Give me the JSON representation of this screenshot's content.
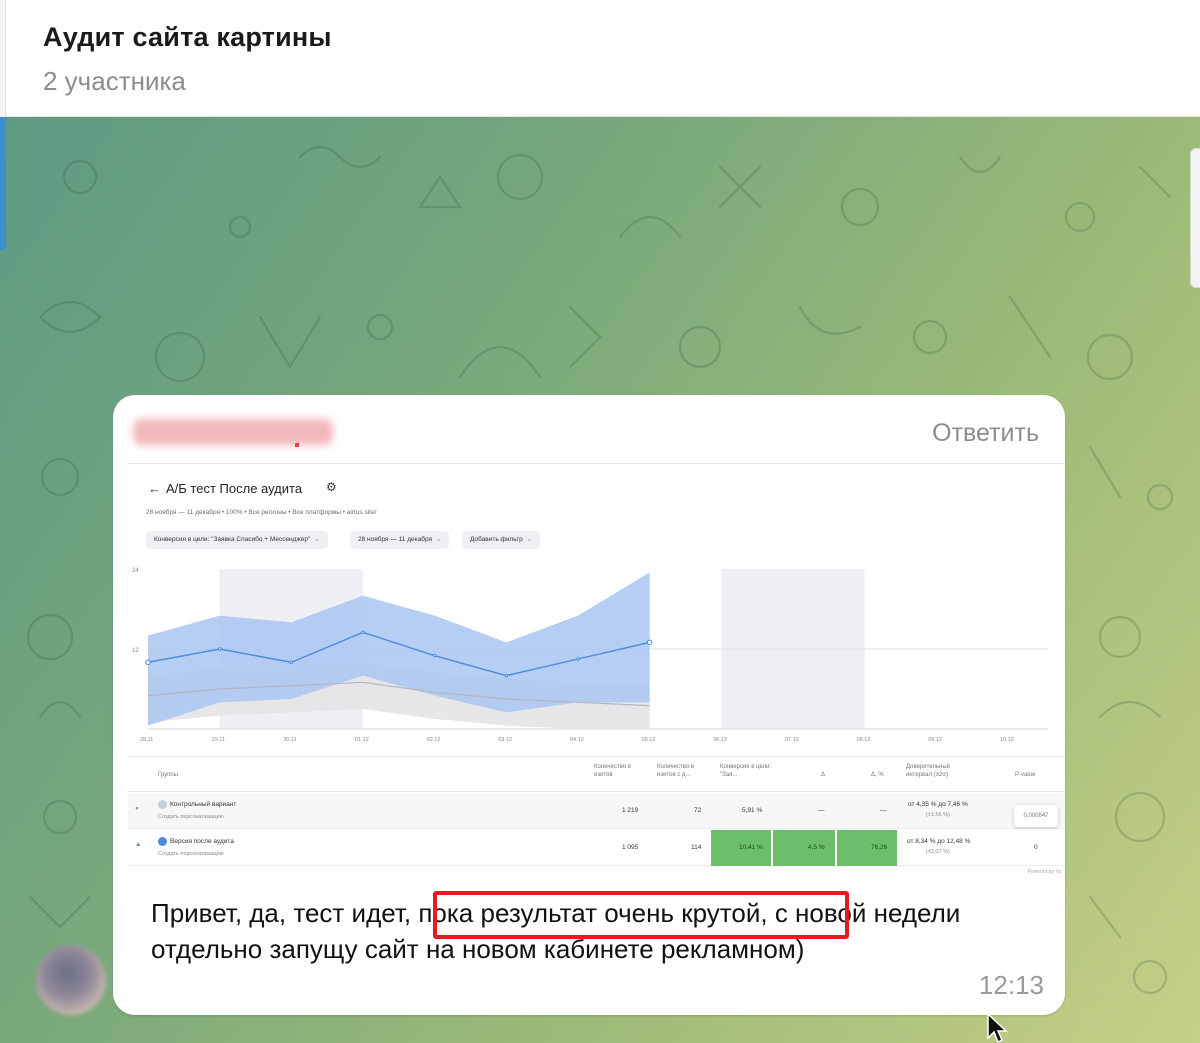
{
  "header": {
    "title": "Аудит сайта картины",
    "subtitle": "2 участника"
  },
  "message": {
    "reply_label": "Ответить",
    "text_before": "Привет, да, тест идет,",
    "text_highlight": " пока результат очень крутой,",
    "text_after": " с новой недели отдельно запущу сайт на новом кабинете рекламном)",
    "time": "12:13"
  },
  "screenshot": {
    "title": "А/Б тест После аудита",
    "meta": "28 ноября — 11 декабря  •  100%  •  Все регионы  •  Все платформы  •  airtus.site/",
    "filters": [
      "Конверсия в цели: \"Заявка Спасибо + Мессенджер\"",
      "28 ноября — 11 декабря",
      "Добавить фильтр"
    ],
    "table": {
      "headers": {
        "groups": "Группы",
        "visits": "Количество в изитов",
        "visits_goal": "Количество в изитов с д...",
        "conversion": "Конверсия в цели: \"Зая...",
        "delta": "Δ",
        "delta_pct": "Δ, %",
        "confidence": "Доверительный интервал (±2σ)",
        "pvalue": "P-value"
      },
      "rows": [
        {
          "name": "Контрольный вариант",
          "sub": "Создать персонализацию",
          "badge": "А",
          "visits": "1 219",
          "visits_goal": "72",
          "conversion": "5,91 %",
          "delta": "—",
          "delta_pct": "—",
          "ci": "от 4,35 % до 7,46 %",
          "ci_sub": "(±1,56 %)",
          "pvalue": "—"
        },
        {
          "name": "Версия после аудита",
          "sub": "Создать персонализацию",
          "badge": "Б",
          "visits": "1 095",
          "visits_goal": "114",
          "conversion": "10,41 %",
          "delta": "4,5 %",
          "delta_pct": "76,26",
          "ci": "от 8,34 % до 12,48 %",
          "ci_sub": "(±2,07 %)",
          "pvalue": "0"
        }
      ],
      "pvalue_tooltip": "0,000847"
    },
    "powered": "Powered by Ya",
    "colors": {
      "band": "#a9c6f2",
      "line": "#4a89dc",
      "green_cell": "#6cbf6a"
    }
  },
  "chart_data": {
    "type": "line",
    "title": "",
    "x": [
      "28.11",
      "29.11",
      "30.11",
      "01.12",
      "02.12",
      "03.12",
      "04.12",
      "05.12",
      "06.12",
      "07.12",
      "08.12",
      "09.12",
      "10.12"
    ],
    "ylim": [
      0,
      24
    ],
    "yticks": [
      "24",
      "12"
    ],
    "series": [
      {
        "values": [
          10,
          12,
          10,
          14.5,
          11,
          8,
          10.5,
          13,
          null,
          null,
          null,
          null,
          null
        ],
        "upper": [
          14,
          17,
          16,
          20,
          17,
          13,
          17,
          23.5,
          null,
          null,
          null,
          null,
          null
        ],
        "lower": [
          0.5,
          4,
          4.5,
          8,
          5,
          2.5,
          4,
          4,
          null,
          null,
          null,
          null,
          null
        ]
      },
      {
        "values": [
          5,
          6,
          6.5,
          7,
          5.5,
          4.5,
          4,
          3.5,
          null,
          null,
          null,
          null,
          null
        ]
      }
    ]
  }
}
